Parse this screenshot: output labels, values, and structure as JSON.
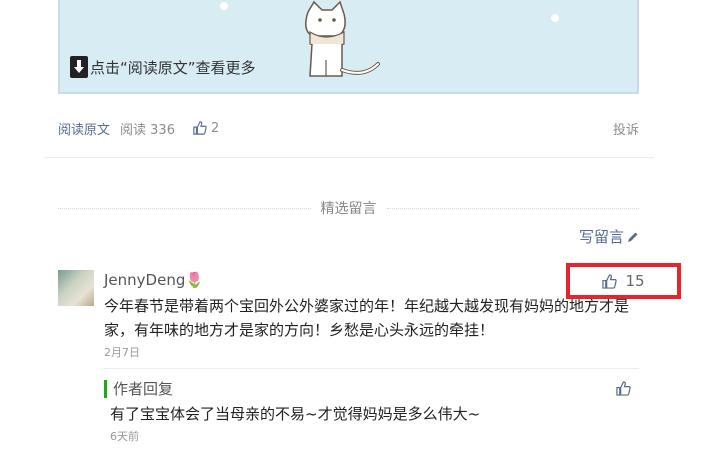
{
  "banner": {
    "read_more": "点击“阅读原文”查看更多"
  },
  "meta": {
    "read_original": "阅读原文",
    "views": "阅读 336",
    "likes": "2",
    "report": "投诉"
  },
  "comments_section": {
    "title": "精选留言",
    "write_comment": "写留言"
  },
  "comment": {
    "nickname": "JennyDeng🌷",
    "text": "今年春节是带着两个宝回外公外婆家过的年！年纪越大越发现有妈妈的地方才是家，有年味的地方才是家的方向！乡愁是心头永远的牵挂！",
    "date": "2月7日",
    "like_count": "15"
  },
  "reply": {
    "label": "作者回复",
    "text": "有了宝宝体会了当母亲的不易~才觉得妈妈是多么伟大~",
    "date": "6天前"
  },
  "colors": {
    "link": "#576b95",
    "highlight": "#e4252b",
    "reply_bar": "#1aad19"
  }
}
